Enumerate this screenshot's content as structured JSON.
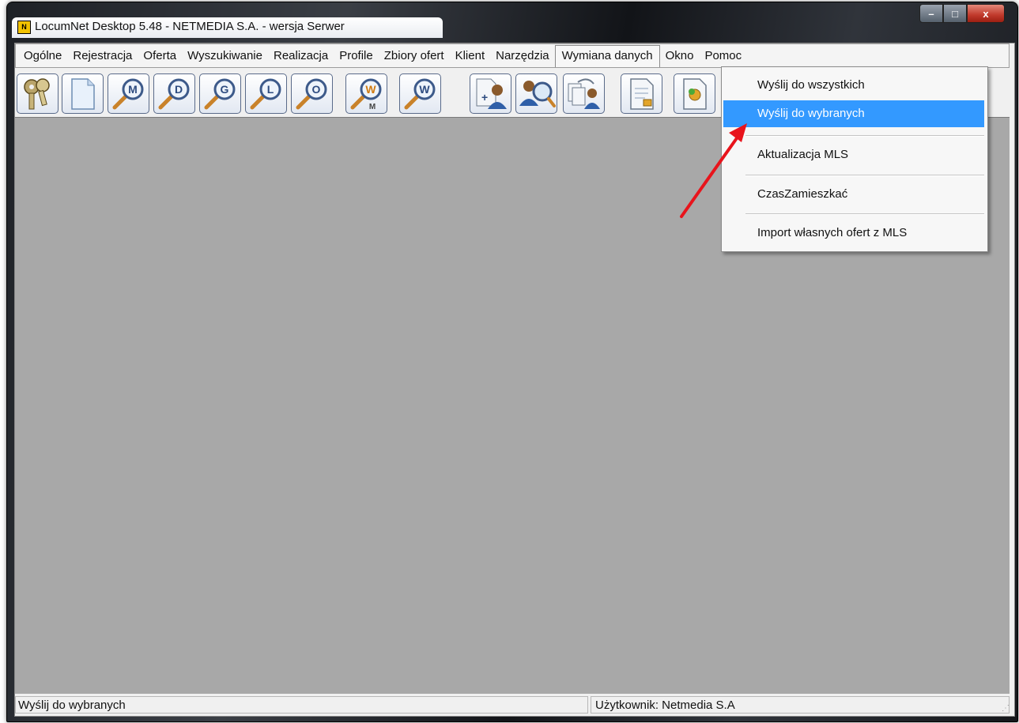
{
  "window": {
    "title": "LocumNet Desktop 5.48 - NETMEDIA S.A. - wersja Serwer",
    "app_icon_text": "N",
    "controls": {
      "minimize": "–",
      "maximize": "□",
      "close": "x"
    }
  },
  "menubar": {
    "items": [
      "Ogólne",
      "Rejestracja",
      "Oferta",
      "Wyszukiwanie",
      "Realizacja",
      "Profile",
      "Zbiory ofert",
      "Klient",
      "Narzędzia",
      "Wymiana danych",
      "Okno",
      "Pomoc"
    ],
    "active_item": "Wymiana danych"
  },
  "toolbar": {
    "buttons": [
      {
        "icon": "keys-icon"
      },
      {
        "icon": "blank-document-icon"
      },
      {
        "icon": "search-m-icon",
        "letter": "M"
      },
      {
        "icon": "search-d-icon",
        "letter": "D"
      },
      {
        "icon": "search-g-icon",
        "letter": "G"
      },
      {
        "icon": "search-l-icon",
        "letter": "L"
      },
      {
        "icon": "search-o-icon",
        "letter": "O"
      },
      {
        "icon": "search-wm-icon",
        "letter": "W",
        "sub": "M"
      },
      {
        "icon": "search-w-icon",
        "letter": "W"
      },
      {
        "icon": "add-client-icon"
      },
      {
        "icon": "search-client-icon"
      },
      {
        "icon": "copy-client-icon"
      },
      {
        "icon": "document-edit-icon"
      },
      {
        "icon": "settings-document-icon"
      }
    ]
  },
  "dropdown": {
    "items": [
      {
        "label": "Wyślij do wszystkich",
        "highlighted": false
      },
      {
        "label": "Wyślij do wybranych",
        "highlighted": true
      },
      {
        "label": "Aktualizacja MLS",
        "highlighted": false
      },
      {
        "label": "CzasZamieszkać",
        "highlighted": false
      },
      {
        "label": "Import własnych ofert z MLS",
        "highlighted": false
      }
    ]
  },
  "statusbar": {
    "left": "Wyślij do wybranych",
    "right": "Użytkownik: Netmedia S.A"
  },
  "colors": {
    "highlight": "#3399ff",
    "workspace": "#a8a8a8",
    "annotation_arrow": "#e8141c"
  }
}
